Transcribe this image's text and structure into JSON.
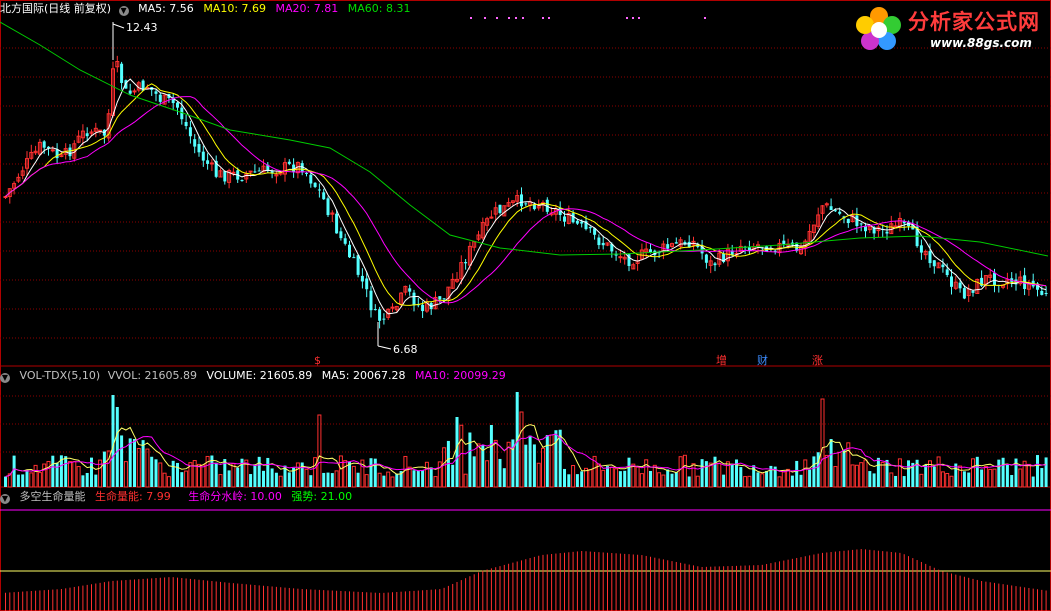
{
  "main_panel": {
    "name": "北方国际(日线 前复权)",
    "indicators": [
      {
        "label": "MA5: 7.56",
        "color": "#ffffff"
      },
      {
        "label": "MA10: 7.69",
        "color": "#ffff00"
      },
      {
        "label": "MA20: 7.81",
        "color": "#ff00ff"
      },
      {
        "label": "MA60: 8.31",
        "color": "#00cc00"
      }
    ],
    "high_label": "12.43",
    "low_label": "6.68",
    "markers": [
      {
        "text": "$",
        "color": "#ff3030"
      },
      {
        "text": "增",
        "color": "#ff3030"
      },
      {
        "text": "财",
        "color": "#3c8cff"
      },
      {
        "text": "涨",
        "color": "#ff3030"
      }
    ]
  },
  "volume_panel": {
    "name": "VOL-TDX(5,10)",
    "indicators": [
      {
        "label": "VVOL: 21605.89",
        "color": "#c0c0c0"
      },
      {
        "label": "VOLUME: 21605.89",
        "color": "#ffffff"
      },
      {
        "label": "MA5: 20067.28",
        "color": "#ffffff"
      },
      {
        "label": "MA10: 20099.29",
        "color": "#ff00ff"
      }
    ]
  },
  "indicator_panel": {
    "name": "多空生命量能",
    "indicators": [
      {
        "label": "生命量能: 7.99",
        "color": "#ff3030"
      },
      {
        "label": "生命分水岭: 10.00",
        "color": "#ff00ff"
      },
      {
        "label": "强势: 21.00",
        "color": "#00ff00"
      }
    ]
  },
  "logo": {
    "title": "分析家公式网",
    "url": "www.88gs.com"
  },
  "colors": {
    "up": "#ff3030",
    "down": "#54ffff",
    "grid": "#8b0000",
    "ma5": "#ffffff",
    "ma10": "#ffff00",
    "ma20": "#ff00ff",
    "ma60": "#00cc00"
  }
}
